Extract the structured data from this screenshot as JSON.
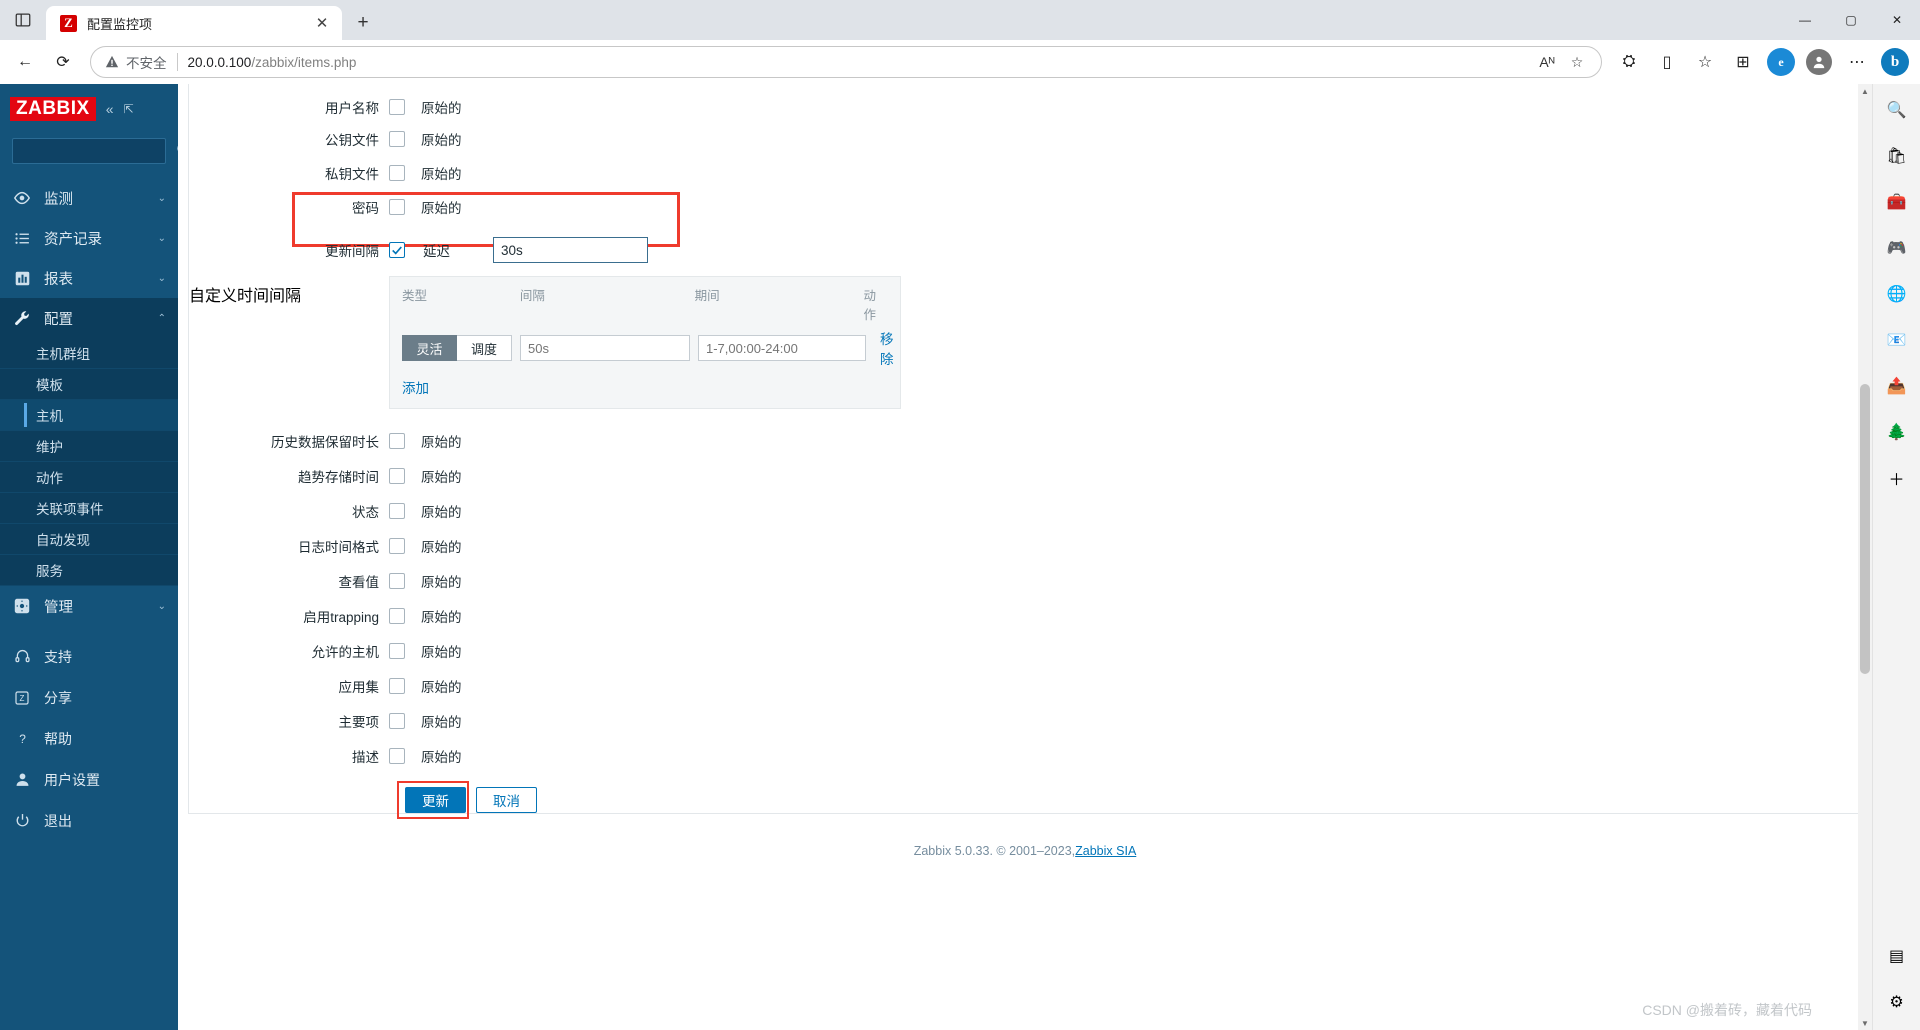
{
  "browser": {
    "tab": {
      "title": "配置监控项",
      "favicon_letter": "Z",
      "close_label": "✕"
    },
    "new_tab_label": "+",
    "window_controls": {
      "minimize": "—",
      "maximize": "▢",
      "close": "✕"
    },
    "nav": {
      "back": "←",
      "refresh": "⟳"
    },
    "omnibox": {
      "warning_text": "不安全",
      "url_host": "20.0.0.100",
      "url_path": "/zabbix/items.php",
      "read_aloud": "Aᴺ",
      "favorite": "☆",
      "split_screen": "▯",
      "collections": "⊞",
      "extensions": "⛭",
      "settings_more": "⋯",
      "profile": "●",
      "bing": "b"
    }
  },
  "sidebar": {
    "logo": "ZABBIX",
    "collapse_icon": "«",
    "expand_icon": "⇱",
    "search_placeholder": "",
    "items": [
      {
        "label": "监测",
        "icon": "eye-icon",
        "chevron": "⌄",
        "active": false
      },
      {
        "label": "资产记录",
        "icon": "list-icon",
        "chevron": "⌄",
        "active": false
      },
      {
        "label": "报表",
        "icon": "chart-icon",
        "chevron": "⌄",
        "active": false
      },
      {
        "label": "配置",
        "icon": "wrench-icon",
        "chevron": "⌃",
        "active": true
      }
    ],
    "submenu": [
      {
        "label": "主机群组",
        "selected": false
      },
      {
        "label": "模板",
        "selected": false
      },
      {
        "label": "主机",
        "selected": true
      },
      {
        "label": "维护",
        "selected": false
      },
      {
        "label": "动作",
        "selected": false
      },
      {
        "label": "关联项事件",
        "selected": false
      },
      {
        "label": "自动发现",
        "selected": false
      },
      {
        "label": "服务",
        "selected": false
      }
    ],
    "admin": {
      "label": "管理",
      "icon": "gear-icon",
      "chevron": "⌄"
    },
    "bottom_items": [
      {
        "label": "支持",
        "icon": "headset-icon"
      },
      {
        "label": "分享",
        "icon": "share-z-icon"
      },
      {
        "label": "帮助",
        "icon": "question-icon"
      },
      {
        "label": "用户设置",
        "icon": "user-icon"
      },
      {
        "label": "退出",
        "icon": "power-icon"
      }
    ]
  },
  "form": {
    "top_rows": [
      {
        "label": "用户名称",
        "checked": false,
        "value": "原始的"
      },
      {
        "label": "公钥文件",
        "checked": false,
        "value": "原始的"
      },
      {
        "label": "私钥文件",
        "checked": false,
        "value": "原始的"
      },
      {
        "label": "密码",
        "checked": false,
        "value": "原始的"
      }
    ],
    "interval_row": {
      "label": "更新间隔",
      "checked": true,
      "inline_label": "延迟",
      "delay_value": "30s"
    },
    "custom_intervals": {
      "label": "自定义时间间隔",
      "headers": {
        "type": "类型",
        "interval": "间隔",
        "period": "期间",
        "action": "动作"
      },
      "rows": [
        {
          "type_options": [
            "灵活",
            "调度"
          ],
          "type_selected": "灵活",
          "interval_placeholder": "50s",
          "interval_value": "",
          "period_placeholder": "1-7,00:00-24:00",
          "period_value": "",
          "remove_label": "移除"
        }
      ],
      "add_label": "添加"
    },
    "bottom_rows": [
      {
        "label": "历史数据保留时长",
        "checked": false,
        "value": "原始的"
      },
      {
        "label": "趋势存储时间",
        "checked": false,
        "value": "原始的"
      },
      {
        "label": "状态",
        "checked": false,
        "value": "原始的"
      },
      {
        "label": "日志时间格式",
        "checked": false,
        "value": "原始的"
      },
      {
        "label": "查看值",
        "checked": false,
        "value": "原始的"
      },
      {
        "label": "启用trapping",
        "checked": false,
        "value": "原始的"
      },
      {
        "label": "允许的主机",
        "checked": false,
        "value": "原始的"
      },
      {
        "label": "应用集",
        "checked": false,
        "value": "原始的"
      },
      {
        "label": "主要项",
        "checked": false,
        "value": "原始的"
      },
      {
        "label": "描述",
        "checked": false,
        "value": "原始的"
      }
    ],
    "buttons": {
      "submit": "更新",
      "cancel": "取消"
    }
  },
  "footer": {
    "text": "Zabbix 5.0.33. © 2001–2023, ",
    "link": "Zabbix SIA"
  },
  "watermark": "CSDN @搬着砖，藏着代码",
  "edge_sidebar": {
    "icons": [
      {
        "name": "search-icon",
        "glyph": "🔍"
      },
      {
        "name": "shopping-icon",
        "glyph": "🛍"
      },
      {
        "name": "tools-icon",
        "glyph": "🧰"
      },
      {
        "name": "games-icon",
        "glyph": "🎮"
      },
      {
        "name": "browser-essentials-icon",
        "glyph": "🌐"
      },
      {
        "name": "outlook-icon",
        "glyph": "📧"
      },
      {
        "name": "office-icon",
        "glyph": "📤"
      },
      {
        "name": "drop-icon",
        "glyph": "🌲"
      },
      {
        "name": "add-icon",
        "glyph": "＋"
      }
    ],
    "bottom_icons": [
      {
        "name": "sidebar-toggle-icon",
        "glyph": "▤"
      },
      {
        "name": "settings-gear-icon",
        "glyph": "⚙"
      }
    ]
  },
  "colors": {
    "zabbix_red": "#e30611",
    "sidebar_bg": "#14537a",
    "accent_blue": "#0275b8",
    "highlight_red": "#ef3b2d"
  }
}
